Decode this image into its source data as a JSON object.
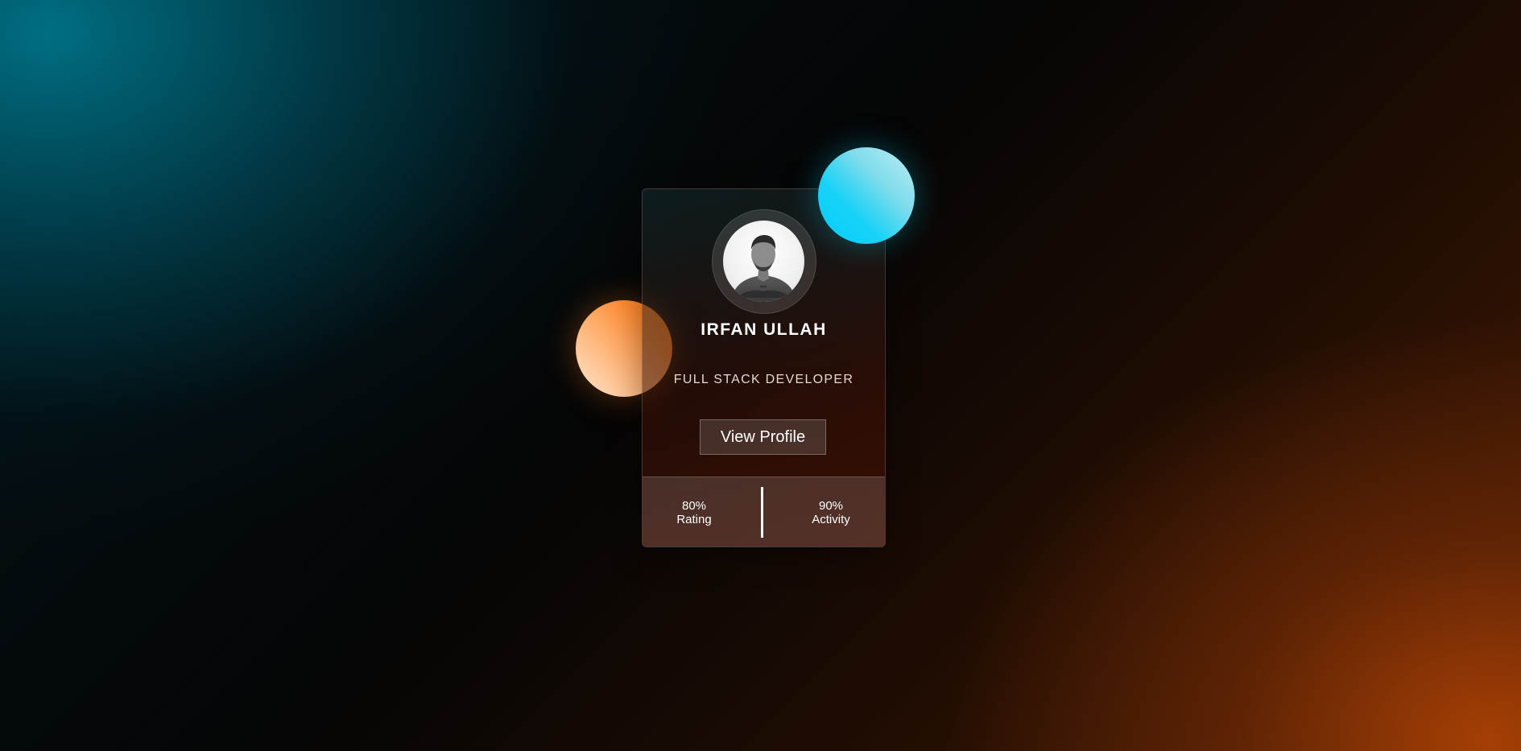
{
  "profile": {
    "name": "IRFAN ULLAH",
    "role": "FULL STACK DEVELOPER",
    "button_label": "View Profile",
    "avatar_icon": "person-photo"
  },
  "stats": [
    {
      "value": "80%",
      "label": "Rating"
    },
    {
      "value": "90%",
      "label": "Activity"
    }
  ],
  "colors": {
    "cyan_orb": "#19d2f5",
    "orange_orb": "#ff8a30",
    "background_teal": "#006e82",
    "background_orange": "#aa4105"
  }
}
